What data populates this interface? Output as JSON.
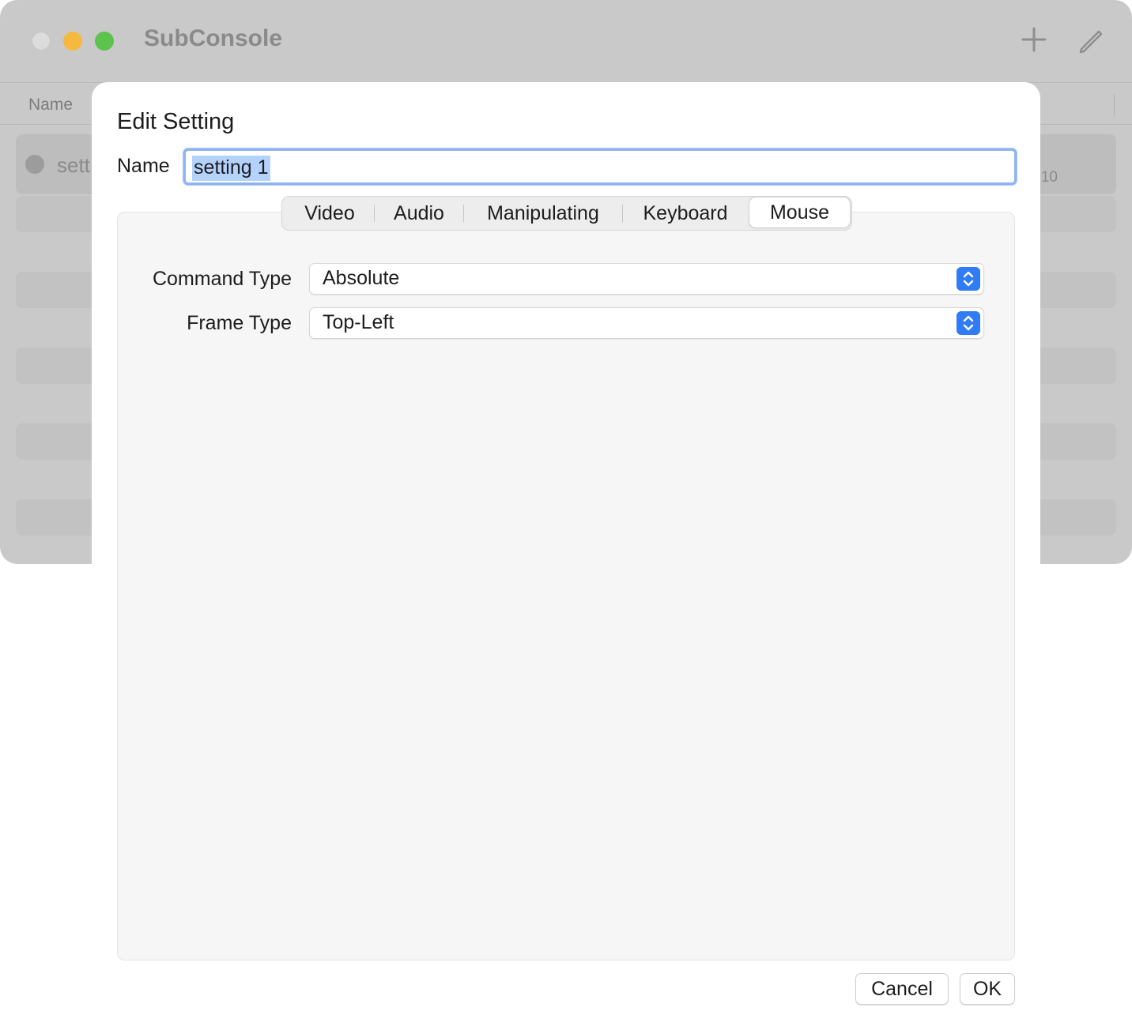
{
  "window": {
    "title": "SubConsole",
    "column_header": "Name",
    "rows": [
      {
        "name": "sett",
        "right_text": "10"
      }
    ]
  },
  "dialog": {
    "title": "Edit Setting",
    "name_label": "Name",
    "name_value": "setting 1",
    "tabs": [
      {
        "label": "Video"
      },
      {
        "label": "Audio"
      },
      {
        "label": "Manipulating"
      },
      {
        "label": "Keyboard"
      },
      {
        "label": "Mouse",
        "active": true
      }
    ],
    "fields": [
      {
        "label": "Command Type",
        "value": "Absolute"
      },
      {
        "label": "Frame Type",
        "value": "Top-Left"
      }
    ],
    "buttons": {
      "cancel": "Cancel",
      "ok": "OK"
    }
  },
  "colors": {
    "accent": "#2f7cf6",
    "selection": "#b4d2fb"
  },
  "icons": [
    "plus-icon",
    "edit-pencil-icon",
    "chevron-up-down-icon"
  ]
}
